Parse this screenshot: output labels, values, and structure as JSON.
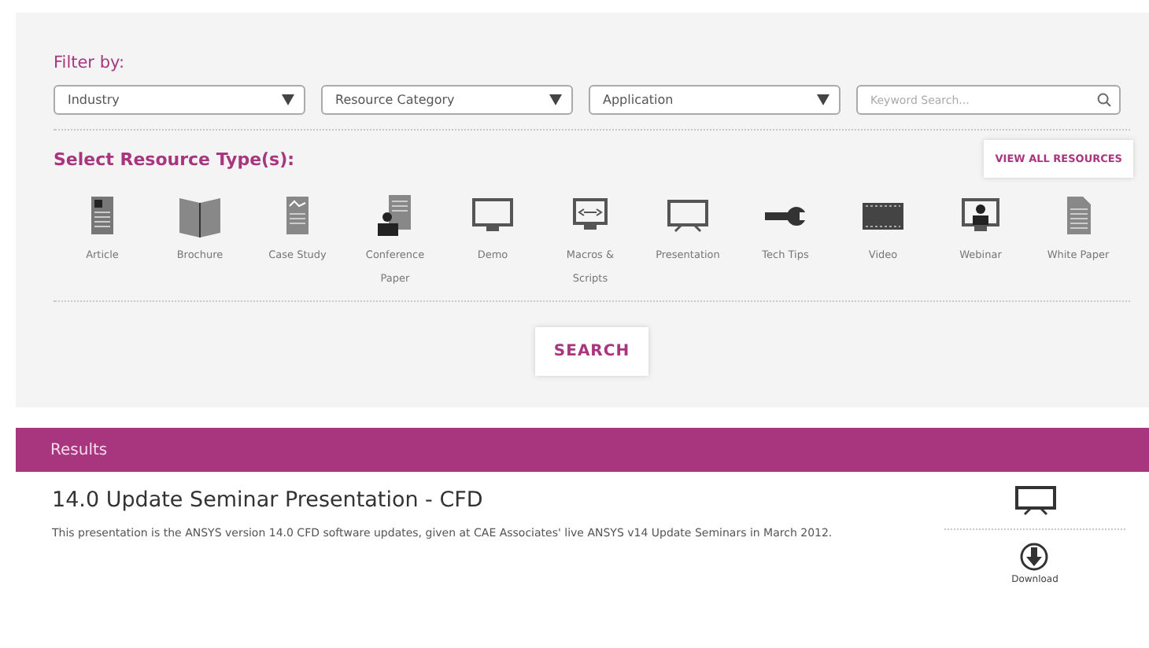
{
  "filter": {
    "title": "Filter by:",
    "dropdowns": [
      {
        "value": "Industry"
      },
      {
        "value": "Resource Category"
      },
      {
        "value": "Application"
      }
    ],
    "search": {
      "placeholder": "Keyword Search..."
    }
  },
  "resource_types": {
    "title": "Select Resource Type(s):",
    "view_all": "VIEW ALL RESOURCES",
    "items": [
      {
        "label": "Article"
      },
      {
        "label": "Brochure"
      },
      {
        "label": "Case Study"
      },
      {
        "label": "Conference Paper"
      },
      {
        "label": "Demo"
      },
      {
        "label": "Macros & Scripts"
      },
      {
        "label": "Presentation"
      },
      {
        "label": "Tech Tips"
      },
      {
        "label": "Video"
      },
      {
        "label": "Webinar"
      },
      {
        "label": "White Paper"
      }
    ]
  },
  "search_button": "SEARCH",
  "results": {
    "title": "Results",
    "items": [
      {
        "title": "14.0 Update Seminar Presentation - CFD",
        "description": "This presentation is the ANSYS version 14.0 CFD software updates, given at CAE Associates' live ANSYS v14 Update Seminars in March 2012.",
        "download": "Download"
      }
    ]
  }
}
